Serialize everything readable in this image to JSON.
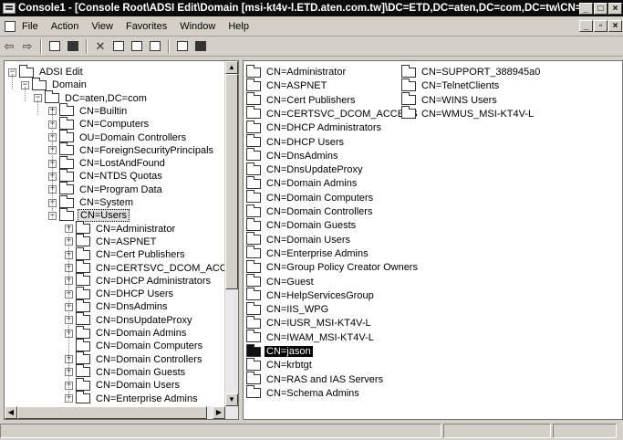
{
  "window": {
    "title": "Console1 - [Console Root\\ADSI Edit\\Domain [msi-kt4v-l.ETD.aten.com.tw]\\DC=ETD,DC=aten,DC=com,DC=tw\\CN=Users]",
    "buttons": [
      "_",
      "□",
      "×"
    ]
  },
  "menu": {
    "items": [
      {
        "label": "File"
      },
      {
        "label": "Action"
      },
      {
        "label": "View"
      },
      {
        "label": "Favorites"
      },
      {
        "label": "Window"
      },
      {
        "label": "Help"
      }
    ],
    "child_buttons": [
      "_",
      "▫",
      "×"
    ]
  },
  "toolbar": {
    "icons": [
      "back-icon",
      "forward-icon",
      "up-folder-icon",
      "show-tree-icon",
      "delete-icon",
      "properties-icon",
      "refresh-icon",
      "export-icon",
      "help-icon",
      "mmc-icon"
    ]
  },
  "tree": {
    "root": "ADSI Edit",
    "domain": "Domain",
    "dc": "DC=aten,DC=com",
    "containers": [
      "CN=Builtin",
      "CN=Computers",
      "OU=Domain Controllers",
      "CN=ForeignSecurityPrincipals",
      "CN=LostAndFound",
      "CN=NTDS Quotas",
      "CN=Program Data",
      "CN=System",
      "CN=Users"
    ],
    "user_children": [
      "CN=Administrator",
      "CN=ASPNET",
      "CN=Cert Publishers",
      "CN=CERTSVC_DCOM_ACCESS",
      "CN=DHCP Administrators",
      "CN=DHCP Users",
      "CN=DnsAdmins",
      "CN=DnsUpdateProxy",
      "CN=Domain Admins",
      "CN=Domain Computers",
      "CN=Domain Controllers",
      "CN=Domain Guests",
      "CN=Domain Users",
      "CN=Enterprise Admins"
    ]
  },
  "list": {
    "column1": [
      "CN=Administrator",
      "CN=ASPNET",
      "CN=Cert Publishers",
      "CN=CERTSVC_DCOM_ACCESS",
      "CN=DHCP Administrators",
      "CN=DHCP Users",
      "CN=DnsAdmins",
      "CN=DnsUpdateProxy",
      "CN=Domain Admins",
      "CN=Domain Computers",
      "CN=Domain Controllers",
      "CN=Domain Guests",
      "CN=Domain Users",
      "CN=Enterprise Admins",
      "CN=Group Policy Creator Owners",
      "CN=Guest",
      "CN=HelpServicesGroup",
      "CN=IIS_WPG",
      "CN=IUSR_MSI-KT4V-L",
      "CN=IWAM_MSI-KT4V-L",
      "CN=jason",
      "CN=krbtgt",
      "CN=RAS and IAS Servers",
      "CN=Schema Admins"
    ],
    "column2": [
      "CN=SUPPORT_388945a0",
      "CN=TelnetClients",
      "CN=WINS Users",
      "CN=WMUS_MSI-KT4V-L"
    ],
    "selected": "CN=jason"
  }
}
